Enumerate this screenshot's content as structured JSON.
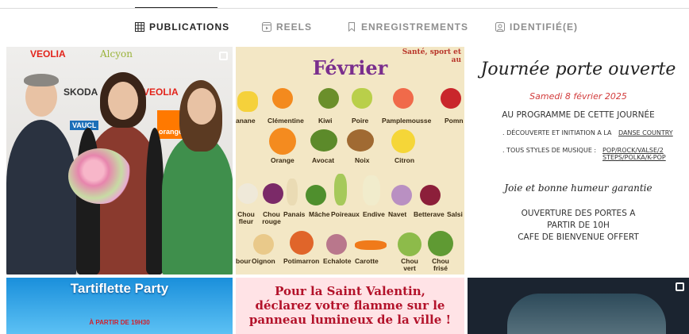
{
  "tabs": [
    {
      "label": "PUBLICATIONS",
      "icon": "grid-icon",
      "active": true
    },
    {
      "label": "REELS",
      "icon": "reels-icon",
      "active": false
    },
    {
      "label": "ENREGISTREMENTS",
      "icon": "bookmark-icon",
      "active": false
    },
    {
      "label": "IDENTIFIÉ(E)",
      "icon": "tagged-icon",
      "active": false
    }
  ],
  "posts": {
    "post1": {
      "logos": [
        "VEOLIA",
        "Alcyon",
        "SKODA",
        "VEOLIA",
        "VAUCL",
        "orange"
      ]
    },
    "post2": {
      "title": "Février",
      "side_text": "Santé, sport et",
      "side_text2": "au",
      "row1": [
        "anane",
        "Clémentine",
        "Kiwi",
        "Poire",
        "Pamplemousse",
        "Pomn"
      ],
      "row2": [
        "Orange",
        "Avocat",
        "Noix",
        "Citron"
      ],
      "row3": [
        "Chou fleur",
        "Chou rouge",
        "Panais",
        "Mâche",
        "Poireaux",
        "Endive",
        "Navet",
        "Betterave",
        "Salsi"
      ],
      "row4": [
        "bour",
        "Oignon",
        "Potimarron",
        "Echalote",
        "Carotte",
        "Chou vert",
        "Chou frisé"
      ]
    },
    "post3": {
      "title": "Journée porte ouverte",
      "date": "Samedi 8 février 2025",
      "programme": "AU PROGRAMME DE CETTE JOURNÉE",
      "line1": ". DÉCOUVERTE ET INITIATION A LA",
      "line1b": "DANSE COUNTRY",
      "line2": ". TOUS STYLES DE MUSIQUE :",
      "line2b": "POP/ROCK/VALSE/2 STEPS/POLKA/K-POP",
      "joie": "Joie et bonne humeur garantie",
      "ouverture1": "OUVERTURE DES PORTES A",
      "ouverture2": "PARTIR DE 10H",
      "cafe": "CAFE DE BIENVENUE OFFERT"
    },
    "post4": {
      "title": "Tartiflette Party",
      "subtitle": "À PARTIR DE 19H30"
    },
    "post5": {
      "line1": "Pour la Saint Valentin,",
      "line2": "déclarez votre flamme sur le",
      "line3": "panneau lumineux de la ville !"
    }
  }
}
